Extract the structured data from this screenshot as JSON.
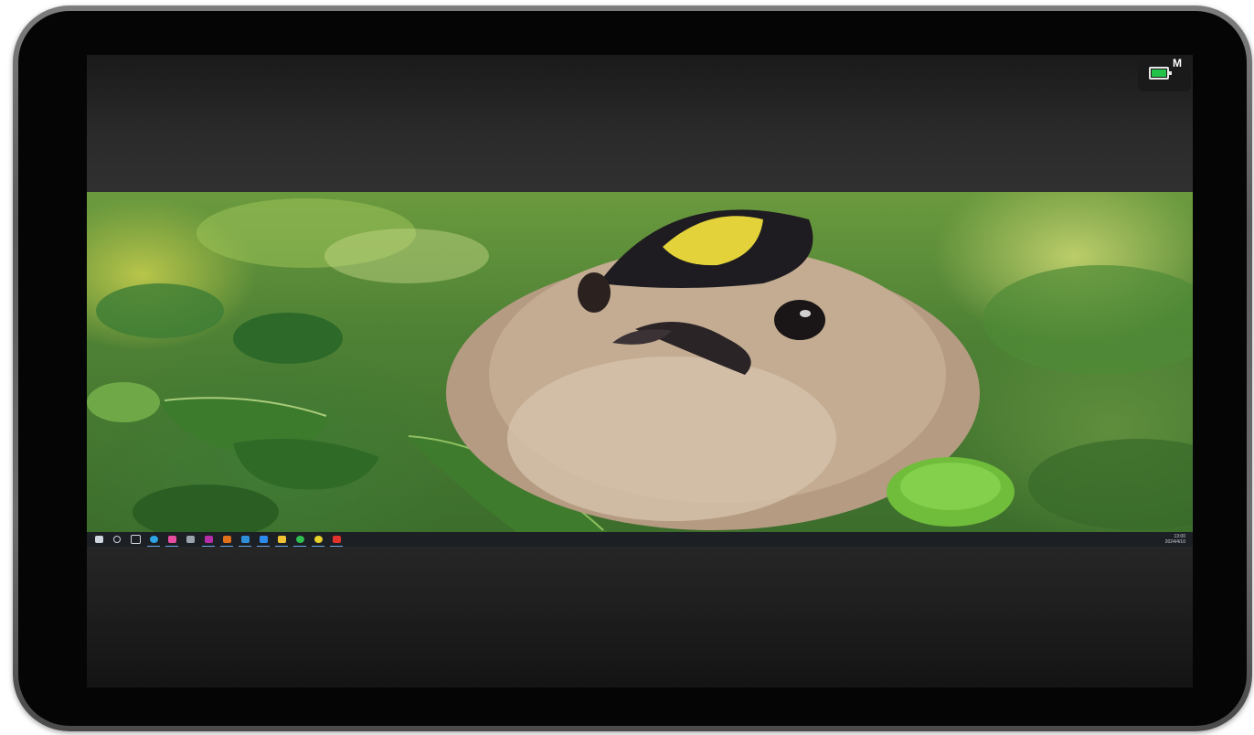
{
  "overlay": {
    "battery_mode_label": "M"
  },
  "taskbar": {
    "clock_time": "13:00",
    "clock_date": "2024/4/10",
    "apps": [
      {
        "icon": "start-windows-icon",
        "color": "#cfd6de"
      },
      {
        "icon": "search-icon",
        "color": "#cfd6de"
      },
      {
        "icon": "task-view-icon",
        "color": "#cfd6de"
      },
      {
        "icon": "edge-browser-icon",
        "color": "#2ea3e6"
      },
      {
        "icon": "pink-app-icon",
        "color": "#e64ca0"
      },
      {
        "icon": "file-app-icon",
        "color": "#9aa4ae"
      },
      {
        "icon": "xd-app-icon",
        "color": "#b52ea8"
      },
      {
        "icon": "ai-app-icon",
        "color": "#e0701a"
      },
      {
        "icon": "ps-app-icon",
        "color": "#2f8ed8"
      },
      {
        "icon": "blue-app-icon",
        "color": "#2d8bf0"
      },
      {
        "icon": "folder-icon",
        "color": "#f1c232"
      },
      {
        "icon": "wechat-icon",
        "color": "#2fbf4e"
      },
      {
        "icon": "yellow-app-icon",
        "color": "#e8d12a"
      },
      {
        "icon": "wps-icon",
        "color": "#e0332b"
      }
    ]
  }
}
